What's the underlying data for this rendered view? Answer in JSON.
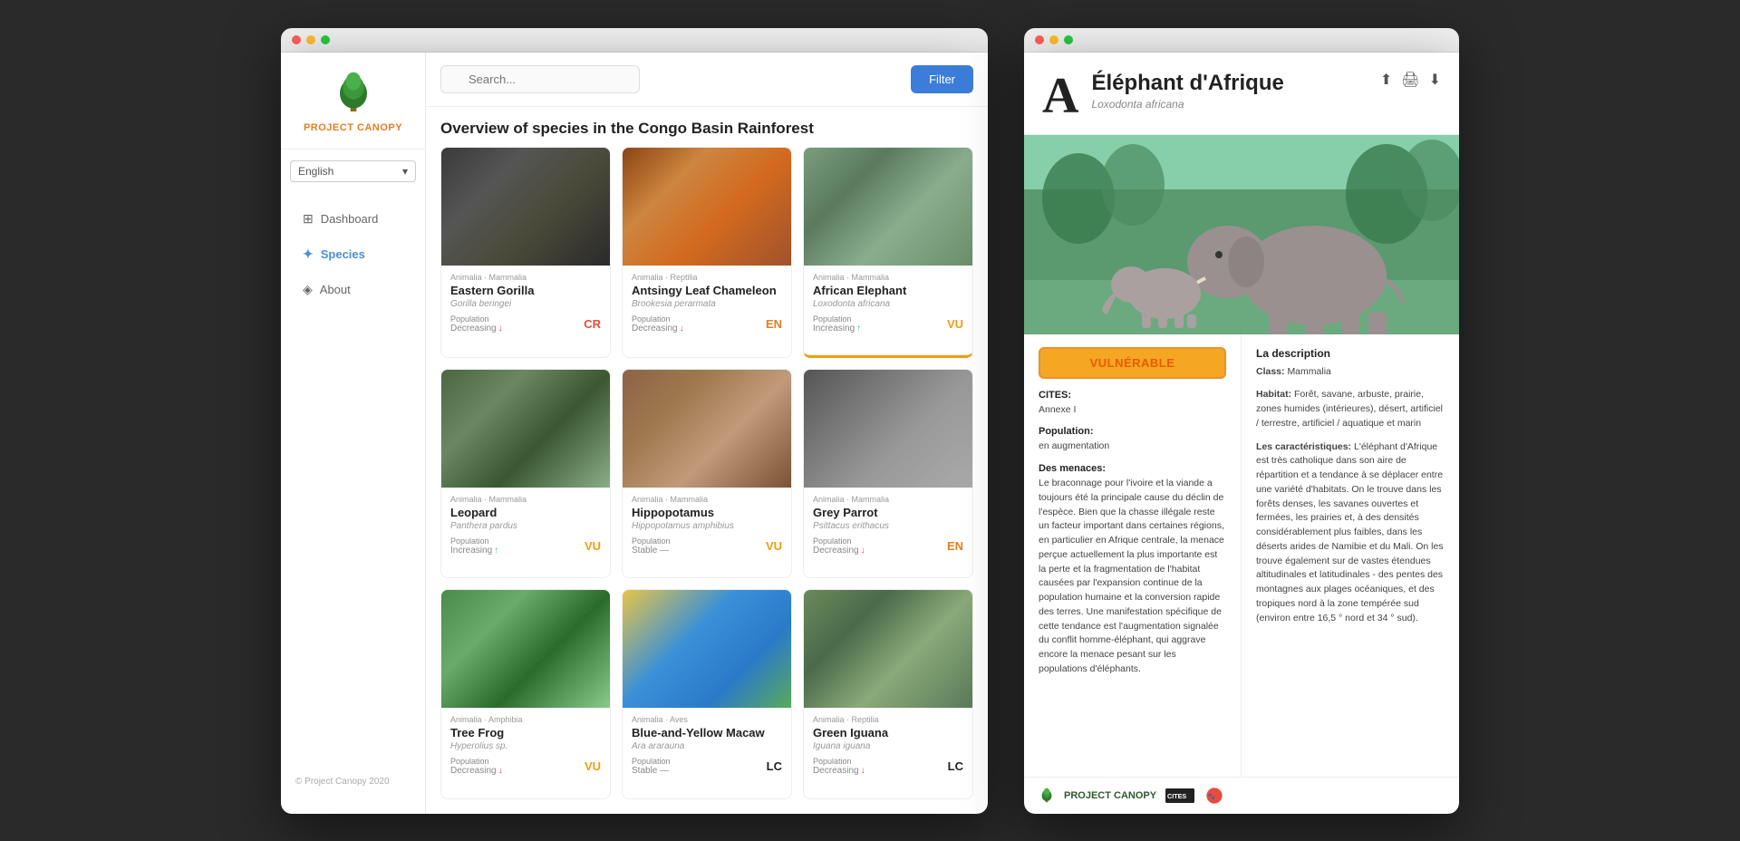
{
  "app": {
    "title": "Project Canopy",
    "logo_text_1": "PROJECT",
    "logo_text_2": "CANOPY",
    "copyright": "© Project Canopy 2020"
  },
  "sidebar": {
    "language": "English",
    "nav": [
      {
        "id": "dashboard",
        "label": "Dashboard",
        "icon": "⊞",
        "active": false
      },
      {
        "id": "species",
        "label": "Species",
        "icon": "✦",
        "active": true
      },
      {
        "id": "about",
        "label": "About",
        "icon": "◈",
        "active": false
      }
    ]
  },
  "search": {
    "placeholder": "Search...",
    "value": ""
  },
  "filter_button": "Filter",
  "page_title": "Overview of species in the Congo Basin Rainforest",
  "species": [
    {
      "id": 1,
      "taxon": "Animalia · Mammalia",
      "name": "Eastern Gorilla",
      "sci_name": "Gorilla beringei",
      "population_label": "Population",
      "population": "Decreasing",
      "pop_direction": "down",
      "status": "CR",
      "img_class": "img-gorilla",
      "selected": false,
      "border_color": "red"
    },
    {
      "id": 2,
      "taxon": "Animalia · Reptilia",
      "name": "Antsingy Leaf Chameleon",
      "sci_name": "Brookesia perarmata",
      "population_label": "Population",
      "population": "Decreasing",
      "pop_direction": "down",
      "status": "EN",
      "img_class": "img-chameleon",
      "selected": false,
      "border_color": "orange"
    },
    {
      "id": 3,
      "taxon": "Animalia · Mammalia",
      "name": "African Elephant",
      "sci_name": "Loxodonta africana",
      "population_label": "Population",
      "population": "Increasing",
      "pop_direction": "up",
      "status": "VU",
      "img_class": "img-elephant",
      "selected": true,
      "border_color": "orange"
    },
    {
      "id": 4,
      "taxon": "Animalia · Mammalia",
      "name": "Leopard",
      "sci_name": "Panthera pardus",
      "population_label": "Population",
      "population": "Increasing",
      "pop_direction": "up",
      "status": "VU",
      "img_class": "img-leopard",
      "selected": false,
      "border_color": "orange"
    },
    {
      "id": 5,
      "taxon": "Animalia · Mammalia",
      "name": "Hippopotamus",
      "sci_name": "Hippopotamus amphibius",
      "population_label": "Population",
      "population": "Stable",
      "pop_direction": "stable",
      "status": "VU",
      "img_class": "img-hippo",
      "selected": false,
      "border_color": "orange"
    },
    {
      "id": 6,
      "taxon": "Animalia · Mammalia",
      "name": "Grey Parrot",
      "sci_name": "Psittacus erithacus",
      "population_label": "Population",
      "population": "Decreasing",
      "pop_direction": "down",
      "status": "EN",
      "img_class": "img-parrot",
      "selected": false,
      "border_color": "orange"
    },
    {
      "id": 7,
      "taxon": "Animalia · Amphibia",
      "name": "Tree Frog",
      "sci_name": "Hyperolius sp.",
      "population_label": "Population",
      "population": "Decreasing",
      "pop_direction": "down",
      "status": "VU",
      "img_class": "img-frog",
      "selected": false,
      "border_color": "orange"
    },
    {
      "id": 8,
      "taxon": "Animalia · Aves",
      "name": "Blue-and-Yellow Macaw",
      "sci_name": "Ara ararauna",
      "population_label": "Population",
      "population": "Stable",
      "pop_direction": "stable",
      "status": "LC",
      "img_class": "img-macaw",
      "selected": false,
      "border_color": "green"
    },
    {
      "id": 9,
      "taxon": "Animalia · Reptilia",
      "name": "Green Iguana",
      "sci_name": "Iguana iguana",
      "population_label": "Population",
      "population": "Decreasing",
      "pop_direction": "down",
      "status": "LC",
      "img_class": "img-lizard",
      "selected": false,
      "border_color": "green"
    }
  ],
  "detail": {
    "letter": "A",
    "title": "Éléphant d'Afrique",
    "sci_name": "Loxodonta africana",
    "status_badge": "VULNÉRABLE",
    "cites_label": "CITES:",
    "cites_value": "Annexe I",
    "population_label": "Population:",
    "population_value": "en augmentation",
    "threats_title": "Des menaces:",
    "threats_text": "Le braconnage pour l'ivoire et la viande a toujours été la principale cause du déclin de l'espèce. Bien que la chasse illégale reste un facteur important dans certaines régions, en particulier en Afrique centrale, la menace perçue actuellement la plus importante est la perte et la fragmentation de l'habitat causées par l'expansion continue de la population humaine et la conversion rapide des terres. Une manifestation spécifique de cette tendance est l'augmentation signalée du conflit homme-éléphant, qui aggrave encore la menace pesant sur les populations d'éléphants.",
    "description_title": "La description",
    "class_label": "Class:",
    "class_value": "Mammalia",
    "habitat_label": "Habitat:",
    "habitat_value": "Forêt, savane, arbuste, prairie, zones humides (intérieures), désert, artificiel / terrestre, artificiel / aquatique et marin",
    "characteristics_label": "Les caractéristiques:",
    "characteristics_text": "L'éléphant d'Afrique est très catholique dans son aire de répartition et a tendance à se déplacer entre une variété d'habitats. On le trouve dans les forêts denses, les savanes ouvertes et fermées, les prairies et, à des densités considérablement plus faibles, dans les déserts arides de Namibie et du Mali. On les trouve également sur de vastes étendues altitudinales et latitudinales - des pentes des montagnes aux plages océaniques, et des tropiques nord à la zone tempérée sud (environ entre 16,5 ° nord et 34 ° sud)."
  }
}
